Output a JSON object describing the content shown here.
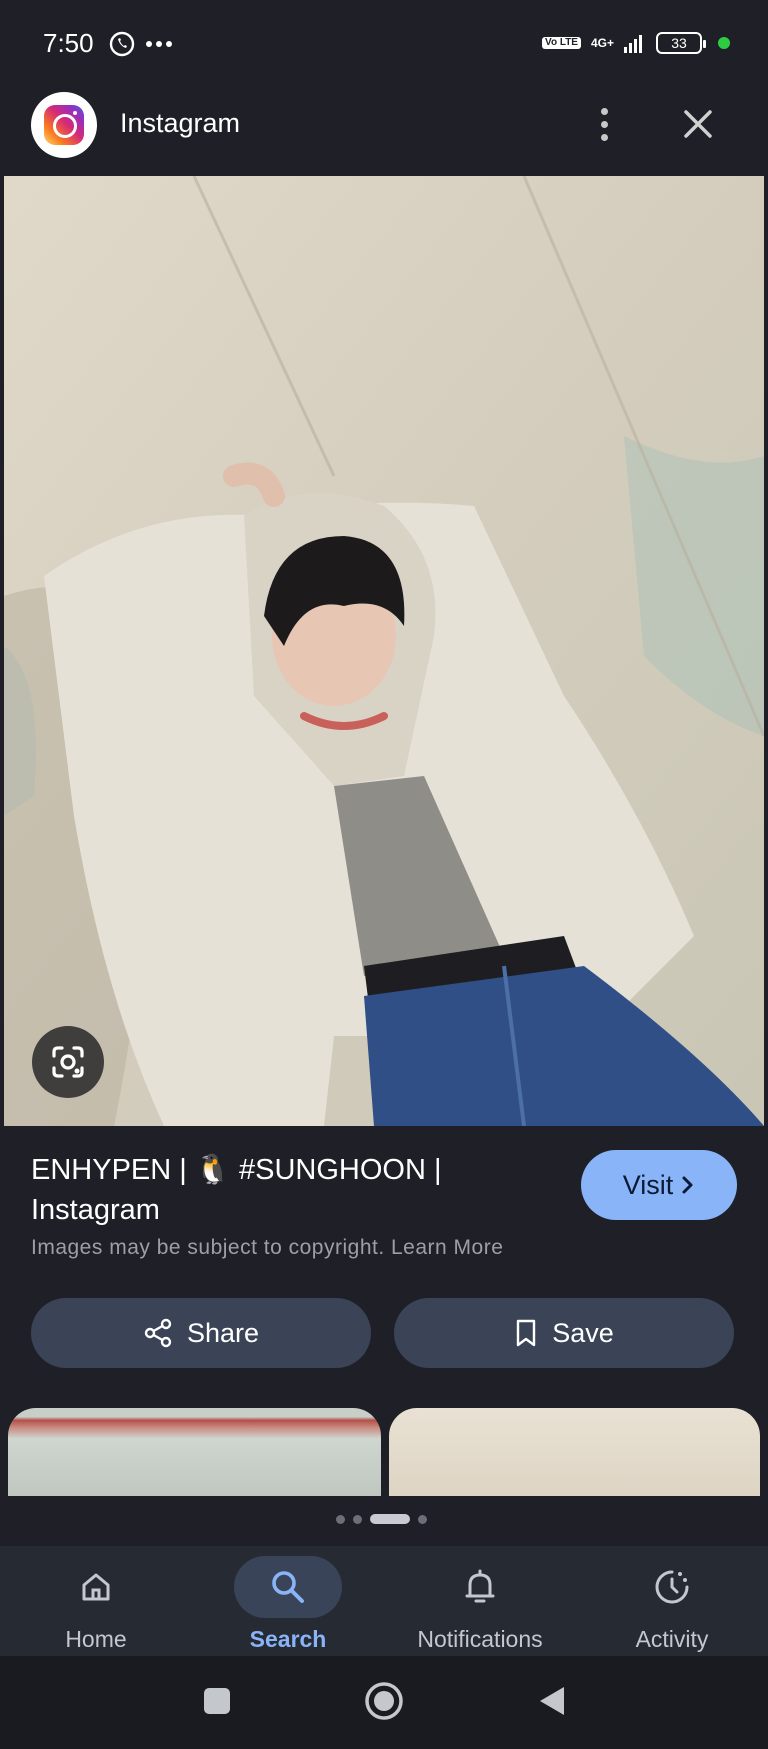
{
  "status_bar": {
    "time": "7:50",
    "network": "4G+",
    "volte": "Vo LTE",
    "battery": "33"
  },
  "header": {
    "app_name": "Instagram",
    "logo_icon": "instagram-icon",
    "more_icon": "more-vert-icon",
    "close_icon": "close-icon"
  },
  "image": {
    "lens_icon": "google-lens-icon"
  },
  "result": {
    "title": "ENHYPEN | 🐧 #SUNGHOON | Instagram",
    "visit_label": "Visit",
    "copyright_text": "Images may be subject to copyright. Learn More",
    "share_label": "Share",
    "save_label": "Save"
  },
  "bottom_nav": {
    "items": [
      {
        "label": "Home",
        "icon": "home-icon"
      },
      {
        "label": "Search",
        "icon": "search-icon",
        "active": true
      },
      {
        "label": "Notifications",
        "icon": "bell-icon"
      },
      {
        "label": "Activity",
        "icon": "activity-icon"
      }
    ]
  },
  "colors": {
    "background": "#1f2027",
    "accent": "#8ab4f8",
    "button": "#3a4456"
  }
}
